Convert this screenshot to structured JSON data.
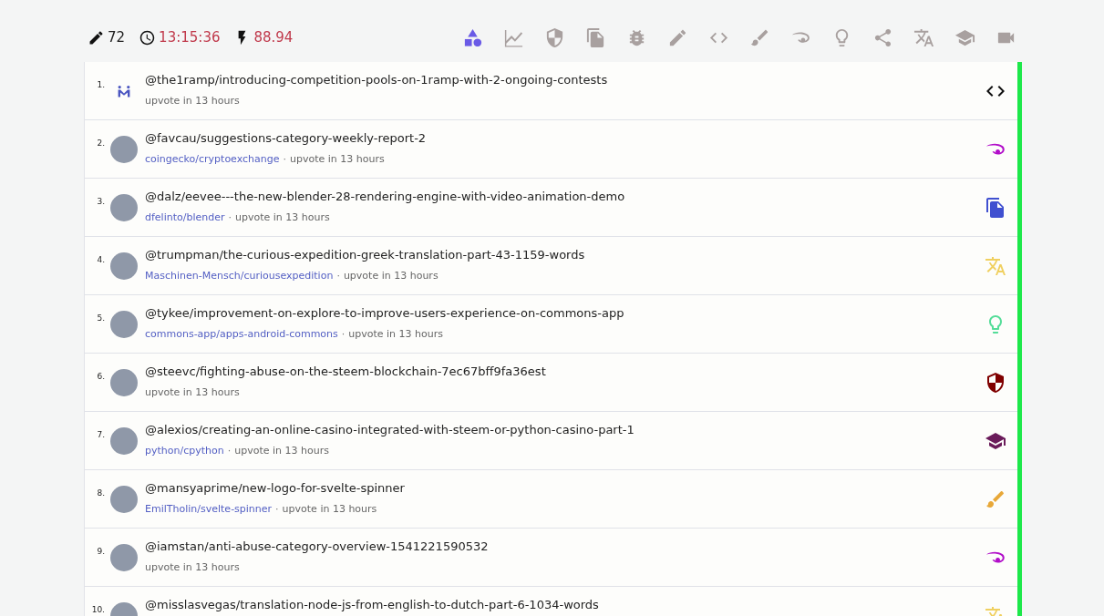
{
  "stats": [
    {
      "kind": "pencil",
      "value": "72",
      "alert": false
    },
    {
      "kind": "clock",
      "value": "13:15:36",
      "alert": true
    },
    {
      "kind": "bolt",
      "value": "88.94",
      "alert": true
    }
  ],
  "filters": [
    {
      "kind": "shapes",
      "selected": true
    },
    {
      "kind": "chart",
      "selected": false
    },
    {
      "kind": "shield",
      "selected": false
    },
    {
      "kind": "copy",
      "selected": false
    },
    {
      "kind": "bug",
      "selected": false
    },
    {
      "kind": "pencil",
      "selected": false
    },
    {
      "kind": "code",
      "selected": false
    },
    {
      "kind": "brush",
      "selected": false
    },
    {
      "kind": "eye",
      "selected": false
    },
    {
      "kind": "bulb",
      "selected": false
    },
    {
      "kind": "share",
      "selected": false
    },
    {
      "kind": "translate",
      "selected": false
    },
    {
      "kind": "school",
      "selected": false
    },
    {
      "kind": "video",
      "selected": false
    }
  ],
  "posts": [
    {
      "number": "1.",
      "avatar": {
        "kind": "logo"
      },
      "title": "@the1ramp/introducing-competition-pools-on-1ramp-with-2-ongoing-contests",
      "meta": "upvote in 13 hours",
      "kind": "code",
      "color": "#111111"
    },
    {
      "number": "2.",
      "avatar": {
        "kind": "photo"
      },
      "title": "@favcau/suggestions-category-weekly-report-2",
      "repo": "coingecko/cryptoexchange",
      "separator": "·",
      "meta": "upvote in 13 hours",
      "kind": "eye",
      "color": "#b10dc9"
    },
    {
      "number": "3.",
      "avatar": {
        "kind": "photo"
      },
      "title": "@dalz/eevee---the-new-blender-28-rendering-engine-with-video-animation-demo",
      "repo": "dfelinto/blender",
      "separator": "·",
      "meta": "upvote in 13 hours",
      "kind": "copy",
      "color": "#4050d0"
    },
    {
      "number": "4.",
      "avatar": {
        "kind": "photo"
      },
      "title": "@trumpman/the-curious-expedition-greek-translation-part-43-1159-words",
      "repo": "Maschinen-Mensch/curiousexpedition",
      "separator": "·",
      "meta": "upvote in 13 hours",
      "kind": "translate",
      "color": "#f0d060"
    },
    {
      "number": "5.",
      "avatar": {
        "kind": "photo"
      },
      "title": "@tykee/improvement-on-explore-to-improve-users-experience-on-commons-app",
      "repo": "commons-app/apps-android-commons",
      "separator": "·",
      "meta": "upvote in 13 hours",
      "kind": "bulb",
      "color": "#55dd99"
    },
    {
      "number": "6.",
      "avatar": {
        "kind": "photo"
      },
      "title": "@steevc/fighting-abuse-on-the-steem-blockchain-7ec67bff9fa36est",
      "meta": "upvote in 13 hours",
      "kind": "shield",
      "color": "#800000"
    },
    {
      "number": "7.",
      "avatar": {
        "kind": "photo"
      },
      "title": "@alexios/creating-an-online-casino-integrated-with-steem-or-python-casino-part-1",
      "repo": "python/cpython",
      "separator": "·",
      "meta": "upvote in 13 hours",
      "kind": "school",
      "color": "#6a1b5a"
    },
    {
      "number": "8.",
      "avatar": {
        "kind": "photo"
      },
      "title": "@mansyaprime/new-logo-for-svelte-spinner",
      "repo": "EmilTholin/svelte-spinner",
      "separator": "·",
      "meta": "upvote in 13 hours",
      "kind": "brush",
      "color": "#e8a838"
    },
    {
      "number": "9.",
      "avatar": {
        "kind": "photo"
      },
      "title": "@iamstan/anti-abuse-category-overview-1541221590532",
      "meta": "upvote in 13 hours",
      "kind": "eye",
      "color": "#b10dc9"
    },
    {
      "number": "10.",
      "avatar": {
        "kind": "photo"
      },
      "title": "@misslasvegas/translation-node-js-from-english-to-dutch-part-6-1034-words",
      "kind": "translate",
      "color": "#f0d060"
    }
  ]
}
